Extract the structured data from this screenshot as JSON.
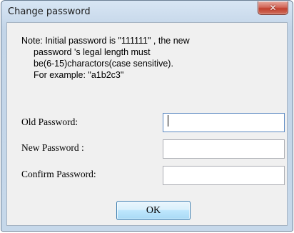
{
  "window": {
    "title": "Change password",
    "close_icon": "close-x-icon"
  },
  "note": {
    "line1": "Note: Initial password is \"111111\" , the new",
    "line2": "password 's legal length must",
    "line3": "be(6-15)charactors(case sensitive).",
    "line4": "For example: \"a1b2c3\""
  },
  "fields": {
    "old_password": {
      "label": "Old Password:",
      "value": ""
    },
    "new_password": {
      "label": "New Password :",
      "value": ""
    },
    "confirm_password": {
      "label": "Confirm Password:",
      "value": ""
    }
  },
  "buttons": {
    "ok_label": "OK"
  },
  "colors": {
    "close_button": "#c8533f",
    "ok_button_border": "#3c7fb1",
    "dialog_bg": "#f0f0f0",
    "frame_bg": "#c9daec"
  }
}
